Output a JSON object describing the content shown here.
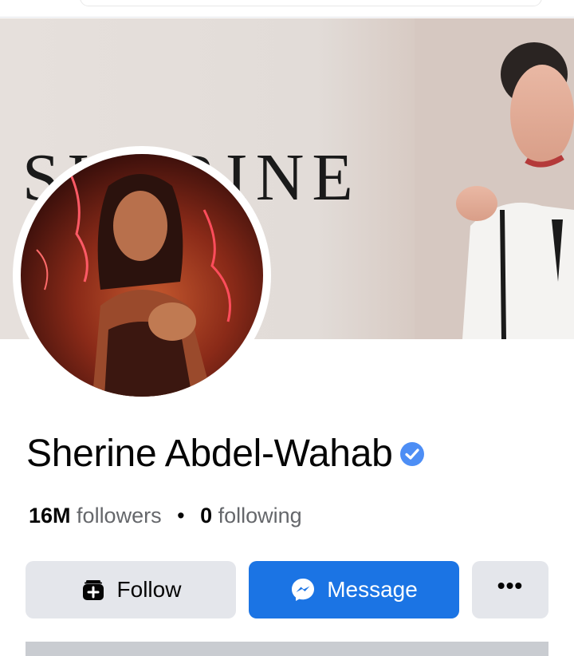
{
  "cover": {
    "brand_text": "SHERINE"
  },
  "profile": {
    "name": "Sherine Abdel-Wahab",
    "verified": true,
    "followers_count": "16M",
    "followers_label": "followers",
    "separator": "•",
    "following_count": "0",
    "following_label": "following"
  },
  "actions": {
    "follow_label": "Follow",
    "message_label": "Message",
    "more_label": "•••"
  },
  "icons": {
    "follow": "add-friend-icon",
    "message": "messenger-icon",
    "verified": "verified-badge-icon",
    "more": "more-dots-icon"
  },
  "colors": {
    "primary": "#1b74e4",
    "secondary_button": "#e4e6eb",
    "verified_badge": "#4d8ef5",
    "muted_text": "#65676b"
  }
}
